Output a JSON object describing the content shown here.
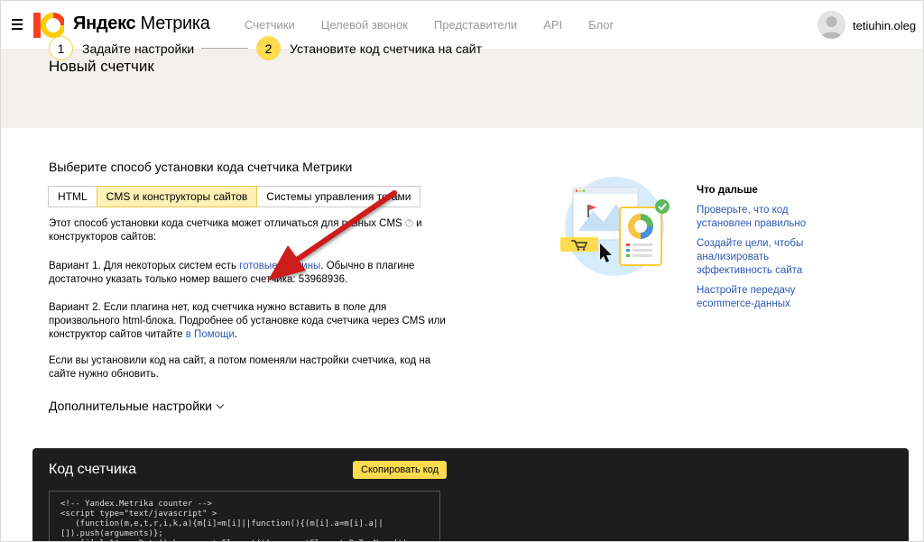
{
  "header": {
    "brand_bold": "Яндекс",
    "brand_thin": "Метрика",
    "nav": [
      "Счетчики",
      "Целевой звонок",
      "Представители",
      "API",
      "Блог"
    ],
    "username": "tetiuhin.oleg"
  },
  "banner": {
    "title": "Новый счетчик",
    "steps": [
      {
        "num": "1",
        "label": "Задайте настройки"
      },
      {
        "num": "2",
        "label": "Установите код счетчика на сайт"
      }
    ]
  },
  "main": {
    "section_title": "Выберите способ установки кода счетчика Метрики",
    "tabs": [
      {
        "label": "HTML",
        "active": false
      },
      {
        "label": "CMS и конструкторы сайтов",
        "active": true
      },
      {
        "label": "Системы управления тегами",
        "active": false
      }
    ],
    "intro_a": "Этот способ установки кода счетчика может отличаться для разных CMS",
    "intro_b": " и конструкторов сайтов:",
    "v1_a": "Вариант 1. Для некоторых систем есть ",
    "v1_link": "готовые плагины",
    "v1_b": ". Обычно в плагине достаточно указать только номер вашего счетчика: 53968936.",
    "v2_a": "Вариант 2. Если плагина нет, код счетчика нужно вставить в поле для произвольного html-блока. Подробнее об установке кода счетчика через CMS или конструктор сайтов читайте ",
    "v2_link": "в Помощи",
    "v2_b": ".",
    "note": "Если вы установили код на сайт, а потом поменяли настройки счетчика, код на сайте нужно обновить.",
    "more_label": "Дополнительные настройки"
  },
  "next": {
    "title": "Что дальше",
    "links": [
      "Проверьте, что код установлен правильно",
      "Создайте цели, чтобы анализировать эффективность сайта",
      "Настройте передачу ecommerce-данных"
    ]
  },
  "code": {
    "title": "Код счетчика",
    "copy_label": "Скопировать код",
    "lines": "<!-- Yandex.Metrika counter -->\n<script type=\"text/javascript\" >\n   (function(m,e,t,r,i,k,a){m[i]=m[i]||function(){(m[i].a=m[i].a||\n[]).push(arguments)};\n   m[i].l=1*new Date();k=e.createElement(t),a=e.getElementsByTagName(t)"
  },
  "colors": {
    "accent_yellow": "#ffdb4d",
    "link_blue": "#2d57b4",
    "arrow_red": "#cc1a1a",
    "banner_bg": "#f3f1ed",
    "code_bg": "#1d1d1d"
  }
}
